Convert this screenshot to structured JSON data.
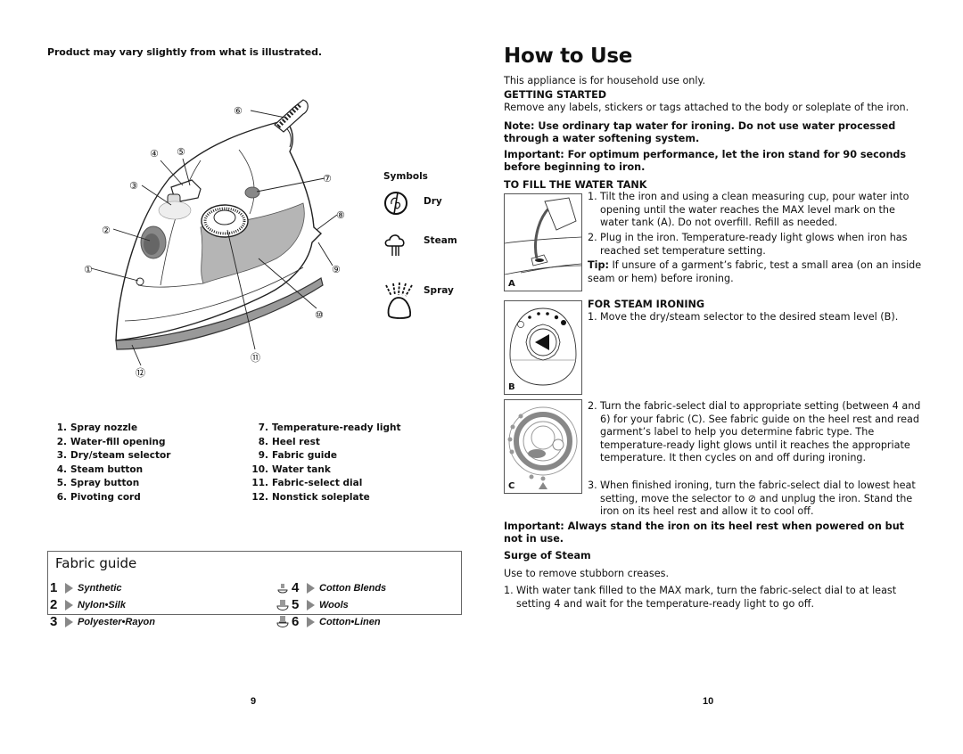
{
  "left_page": {
    "note": "Product may vary slightly from what is illustrated.",
    "callout_numbers": [
      "①",
      "②",
      "③",
      "④",
      "⑤",
      "⑥",
      "⑦",
      "⑧",
      "⑨",
      "⑩",
      "⑪",
      "⑫"
    ],
    "symbols": {
      "title": "Symbols",
      "items": [
        {
          "icon": "dry-icon",
          "label": "Dry"
        },
        {
          "icon": "steam-icon",
          "label": "Steam"
        },
        {
          "icon": "spray-icon",
          "label": "Spray"
        }
      ]
    },
    "parts": [
      {
        "num": "1.",
        "label": "Spray nozzle"
      },
      {
        "num": "2.",
        "label": "Water-fill opening"
      },
      {
        "num": "3.",
        "label": "Dry/steam selector"
      },
      {
        "num": "4.",
        "label": "Steam button"
      },
      {
        "num": "5.",
        "label": "Spray button"
      },
      {
        "num": "6.",
        "label": "Pivoting cord"
      },
      {
        "num": "7.",
        "label": "Temperature-ready light"
      },
      {
        "num": "8.",
        "label": "Heel rest"
      },
      {
        "num": "9.",
        "label": "Fabric guide"
      },
      {
        "num": "10.",
        "label": "Water tank"
      },
      {
        "num": "11.",
        "label": "Fabric-select dial"
      },
      {
        "num": "12.",
        "label": "Nonstick soleplate"
      }
    ],
    "fabric_guide": {
      "title": "Fabric guide",
      "settings": [
        {
          "num": "1",
          "label": "Synthetic",
          "icon": null
        },
        {
          "num": "2",
          "label": "Nylon•Silk",
          "icon": null
        },
        {
          "num": "3",
          "label": "Polyester•Rayon",
          "icon": null
        },
        {
          "num": "4",
          "label": "Cotton Blends",
          "icon": "steam-low-icon"
        },
        {
          "num": "5",
          "label": "Wools",
          "icon": "steam-medium-icon"
        },
        {
          "num": "6",
          "label": "Cotton•Linen",
          "icon": "steam-high-icon"
        }
      ]
    },
    "page_number": "9"
  },
  "right_page": {
    "title": "How to Use",
    "intro": "This appliance is for household use only.",
    "getting_started": {
      "heading": "GETTING STARTED",
      "text": "Remove any labels, stickers or tags attached to the body or soleplate of the iron.",
      "note": "Note: Use ordinary tap water for ironing. Do not use water processed through a water softening system.",
      "important": "Important: For optimum performance, let the iron stand for 90 seconds before beginning to iron."
    },
    "fill_tank": {
      "heading": "TO FILL THE WATER TANK",
      "figure_label": "A",
      "steps": [
        {
          "n": "1.",
          "text": "Tilt the iron and using a clean measuring cup, pour water into opening until the water reaches the MAX level mark on the water tank (A). Do not overfill. Refill as needed."
        },
        {
          "n": "2.",
          "text": "Plug in the iron. Temperature-ready light glows when iron has reached set temperature setting."
        }
      ],
      "tip_label": "Tip:",
      "tip_text": " If unsure of a garment’s fabric, test a small area (on an inside seam or hem) before ironing."
    },
    "steam_ironing": {
      "heading": "FOR STEAM IRONING",
      "figure_b_label": "B",
      "figure_c_label": "C",
      "steps": [
        {
          "n": "1.",
          "text": "Move the dry/steam selector to the desired steam level (B)."
        },
        {
          "n": "2.",
          "text": "Turn the fabric-select dial to appropriate setting (between 4 and 6) for your fabric (C). See fabric guide on the heel rest and read garment’s label to help you determine fabric type. The temperature-ready light glows until it reaches the appropriate temperature. It then cycles on and off during ironing."
        },
        {
          "n": "3.",
          "text": "When finished ironing, turn the fabric-select dial to lowest heat setting, move the selector to ⊘ and unplug the iron. Stand the iron on its heel rest and allow it to cool off."
        }
      ]
    },
    "important_heel": "Important: Always stand the iron on its heel rest when powered on but not in use.",
    "surge": {
      "heading": "Surge of Steam",
      "intro": "Use to remove stubborn creases.",
      "steps": [
        {
          "n": "1.",
          "text": "With water tank filled to the MAX mark, turn the fabric-select dial to at least setting 4 and wait for the temperature-ready light to go off."
        }
      ]
    },
    "page_number": "10"
  }
}
